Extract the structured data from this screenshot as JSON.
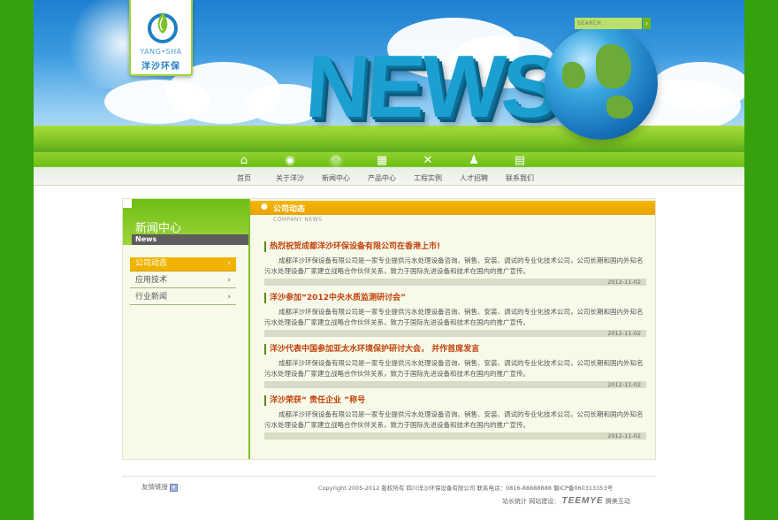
{
  "header": {
    "logo_en": "YANG•SHA",
    "logo_cn": "洋沙环保",
    "banner_word": "NEWS",
    "search_placeholder": "SEARCH",
    "search_button": "›"
  },
  "nav": {
    "items": [
      {
        "label": "首页",
        "icon": "home-icon",
        "glyph": "⌂",
        "active": false
      },
      {
        "label": "关于洋沙",
        "icon": "drop-icon",
        "glyph": "◉",
        "active": false
      },
      {
        "label": "新闻中心",
        "icon": "wifi-icon",
        "glyph": "◠",
        "active": true
      },
      {
        "label": "产品中心",
        "icon": "blocks-icon",
        "glyph": "▦",
        "active": false
      },
      {
        "label": "工程实例",
        "icon": "tools-icon",
        "glyph": "✕",
        "active": false
      },
      {
        "label": "人才招聘",
        "icon": "add-user-icon",
        "glyph": "♟",
        "active": false
      },
      {
        "label": "联系我们",
        "icon": "book-icon",
        "glyph": "▤",
        "active": false
      }
    ]
  },
  "sidebar": {
    "title": "新闻中心",
    "subtitle": "News",
    "items": [
      {
        "label": "公司动态",
        "arrow": "›",
        "active": true
      },
      {
        "label": "应用技术",
        "arrow": "›",
        "active": false
      },
      {
        "label": "行业新闻",
        "arrow": "›",
        "active": false
      }
    ]
  },
  "main": {
    "category_title": "公司动态",
    "category_sub": "COMPANY NEWS",
    "articles": [
      {
        "title": "热烈祝贺成都洋沙环保设备有限公司在香港上市!",
        "body_1": "成都洋沙环保设备有限公司是一家专业提供污水处理设备咨询、销售、安装、调试的专业化技术公司，公司长期和国内外知名",
        "body_2": "污水处理设备厂家建立战略合作伙伴关系，致力于国际先进设备和技术在国内的推广宣传。",
        "date": "2012-11-02"
      },
      {
        "title": "洋沙参加“2012中央水质监测研讨会”",
        "body_1": "成都洋沙环保设备有限公司是一家专业提供污水处理设备咨询、销售、安装、调试的专业化技术公司，公司长期和国内外知名",
        "body_2": "污水处理设备厂家建立战略合作伙伴关系，致力于国际先进设备和技术在国内的推广宣传。",
        "date": "2012-11-02"
      },
      {
        "title": "洋沙代表中国参加亚太水环境保护研讨大会， 并作首席发言",
        "body_1": "成都洋沙环保设备有限公司是一家专业提供污水处理设备咨询、销售、安装、调试的专业化技术公司，公司长期和国内外知名",
        "body_2": "污水处理设备厂家建立战略合作伙伴关系，致力于国际先进设备和技术在国内的推广宣传。",
        "date": "2012-11-02"
      },
      {
        "title": "洋沙荣获“ 责任企业 ”称号",
        "body_1": "成都洋沙环保设备有限公司是一家专业提供污水处理设备咨询、销售、安装、调试的专业化技术公司，公司长期和国内外知名",
        "body_2": "污水处理设备厂家建立战略合作伙伴关系，致力于国际先进设备和技术在国内的推广宣传。",
        "date": "2012-11-02"
      }
    ]
  },
  "footer": {
    "friend_links": "友情链接",
    "copyright": "Copyright 2005-2012 版权所有 四川洋沙环保设备有限公司 联系电话：0816-88888888 蜀ICP备060313353号",
    "credits_prefix": "站长统计 网站建设：",
    "credits_brand": "TEEMYE",
    "credits_suffix": "腾美互动"
  },
  "colors": {
    "page_green": "#34a10d",
    "accent_orange": "#f0b400",
    "title_red": "#c2410c"
  }
}
